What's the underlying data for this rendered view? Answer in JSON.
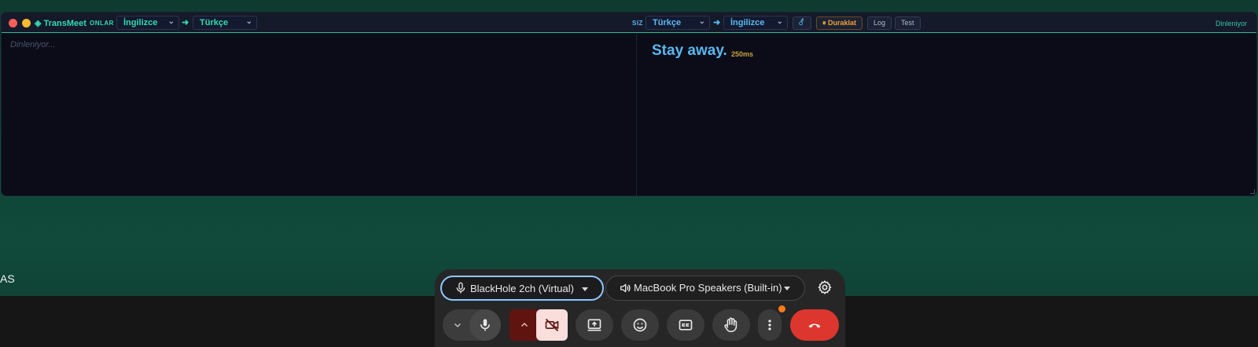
{
  "transmeet": {
    "brand": "◈ TransMeet",
    "them": {
      "label": "ONLAR",
      "source_lang": "İngilizce",
      "target_lang": "Türkçe",
      "placeholder": "Dinleniyor..."
    },
    "you": {
      "label": "SIZ",
      "source_lang": "Türkçe",
      "target_lang": "İngilizce",
      "translation": "Stay away.",
      "latency": "250ms"
    },
    "arrow": "➜",
    "chevron": "⌄",
    "buttons": {
      "swap": "⚦",
      "pause": "⏸ Duraklat",
      "log": "Log",
      "test": "Test"
    },
    "status": "Dinleniyor",
    "colors": {
      "accent": "#34d9b0",
      "translation": "#5ab8f0",
      "pause": "#f0a030",
      "latency": "#c7a33a"
    }
  },
  "background": {
    "stray_text": "AS"
  },
  "meet": {
    "mic_device": "BlackHole 2ch (Virtual)",
    "speaker_device": "MacBook Pro Speakers (Built-in)",
    "controls": [
      "audio-options",
      "microphone",
      "video-options",
      "camera-off",
      "present",
      "reactions",
      "captions",
      "raise-hand",
      "more-options",
      "leave-call"
    ],
    "colors": {
      "leave": "#dc362e",
      "camera_off": "#f9dedc",
      "camera_options": "#601410",
      "notification": "#fa7b17"
    }
  }
}
